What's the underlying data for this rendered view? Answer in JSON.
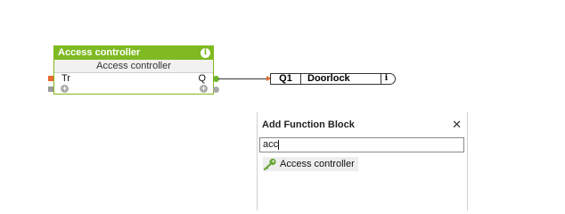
{
  "function_block": {
    "title": "Access controller",
    "subtitle": "Access controller",
    "info_icon": "info-icon",
    "input_label": "Tr",
    "output_label": "Q",
    "colors": {
      "header": "#7fba22",
      "input_pin": "#e8692d",
      "output_pin": "#6fb52a"
    }
  },
  "output_tag": {
    "name": "Q1",
    "label": "Doorlock",
    "info_icon": "info-icon"
  },
  "add_panel": {
    "title": "Add Function Block",
    "close": "✕",
    "search_value": "acc",
    "results": [
      {
        "label": "Access controller",
        "icon": "key-icon"
      }
    ]
  }
}
